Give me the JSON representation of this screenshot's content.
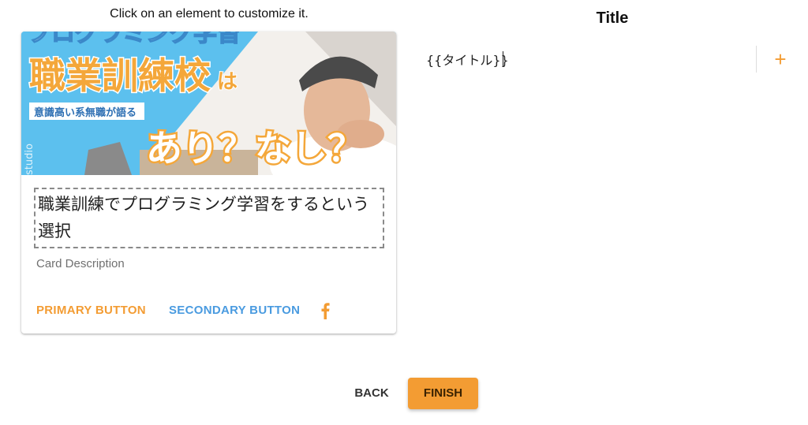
{
  "hint": "Click on an element to customize it.",
  "card": {
    "image": {
      "top_banner": "プログラミング学習",
      "headline": "職業訓練校",
      "headline_suffix": "は",
      "tag": "意識高い系無職が語る",
      "big_text": "あり？なし？",
      "studio": "studio"
    },
    "title": "職業訓練でプログラミング学習をするという選択",
    "description": "Card Description",
    "primary_button": "PRIMARY BUTTON",
    "secondary_button": "SECONDARY BUTTON",
    "social_icon": "facebook-icon"
  },
  "panel": {
    "title": "Title",
    "input_value": "{{タイトル}}",
    "add_icon": "+"
  },
  "footer": {
    "back": "BACK",
    "finish": "FINISH"
  },
  "colors": {
    "accent": "#f39c33",
    "secondary": "#4a9be0"
  }
}
